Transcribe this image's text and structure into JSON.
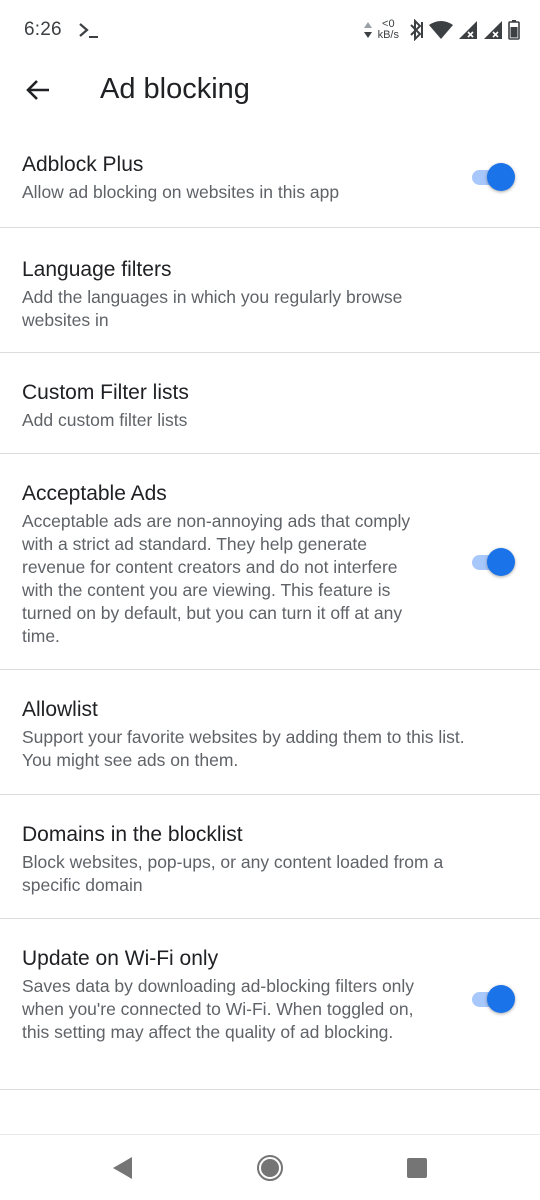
{
  "status_bar": {
    "time": "6:26",
    "speed_value": "<0",
    "speed_unit": "kB/s",
    "icons": [
      "terminal-icon",
      "data-arrows-icon",
      "bluetooth-icon",
      "wifi-icon",
      "signal-icon",
      "signal-icon",
      "battery-icon"
    ]
  },
  "app_bar": {
    "title": "Ad blocking",
    "back_icon": "arrow-back-icon"
  },
  "settings": [
    {
      "title": "Adblock Plus",
      "subtitle": "Allow ad blocking on websites in this app",
      "toggle": true
    },
    {
      "title": "Language filters",
      "subtitle": "Add the languages in which you regularly browse websites in"
    },
    {
      "title": "Custom Filter lists",
      "subtitle": "Add custom filter lists"
    },
    {
      "title": "Acceptable Ads",
      "subtitle": "Acceptable ads are non-annoying ads that comply with a strict ad standard. They help generate revenue for content creators and do not interfere with the content you are viewing. This feature is turned on by default, but you can turn it off at any time.",
      "toggle": true
    },
    {
      "title": "Allowlist",
      "subtitle": "Support your favorite websites by adding them to this list. You might see ads on them."
    },
    {
      "title": "Domains in the blocklist",
      "subtitle": "Block websites, pop-ups, or any content loaded from a specific domain"
    },
    {
      "title": "Update on Wi-Fi only",
      "subtitle": "Saves data by downloading ad-blocking filters only when you're connected to Wi-Fi. When toggled on, this setting may affect the quality of ad blocking.",
      "toggle": true
    }
  ],
  "colors": {
    "accent": "#1a73e8",
    "accent_track": "#a8c7fa",
    "divider": "#dadce0"
  },
  "nav_bar": {
    "icons": [
      "back-triangle-icon",
      "home-circle-icon",
      "recents-square-icon"
    ]
  }
}
